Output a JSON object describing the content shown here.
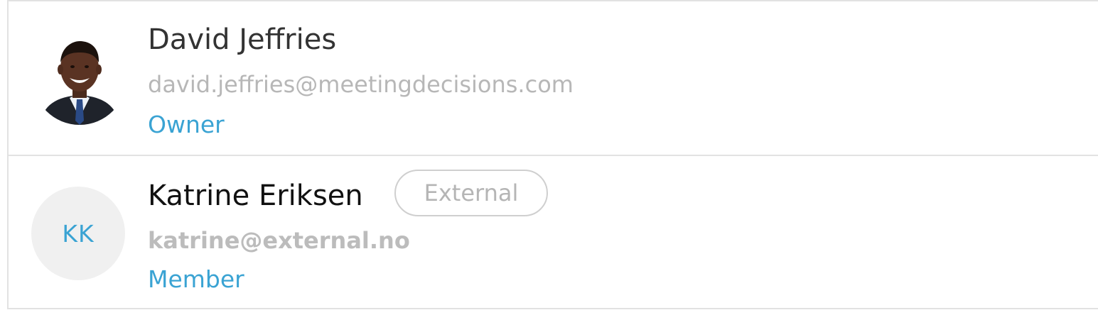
{
  "members": [
    {
      "name": "David Jeffries",
      "email": "david.jeffries@meetingdecisions.com",
      "role": "Owner",
      "avatar": "photo",
      "badge": ""
    },
    {
      "name": "Katrine Eriksen",
      "email": "katrine@external.no",
      "role": "Member",
      "avatar": "initials",
      "initials": "KK",
      "badge": "External"
    }
  ],
  "colors": {
    "accent": "#3aa3d3",
    "muted_text": "#b7b7b7",
    "divider": "#e2e2e2",
    "initials_bg": "#f0f0f0"
  }
}
